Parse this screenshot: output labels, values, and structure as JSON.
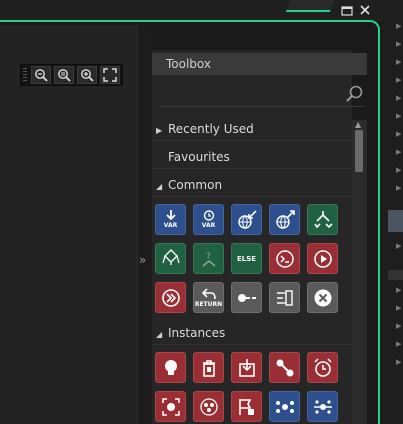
{
  "window": {
    "restore_icon": "restore-icon",
    "close_icon": "close-icon"
  },
  "zoom_toolbar": {
    "buttons": [
      "zoom-out-icon",
      "zoom-reset-icon",
      "zoom-in-icon",
      "fit-screen-icon"
    ]
  },
  "splitter": {
    "expand_label": "»"
  },
  "toolbox": {
    "title": "Toolbox",
    "search": {
      "placeholder": "",
      "value": ""
    },
    "sections": {
      "recently_used": {
        "label": "Recently Used",
        "expanded": false
      },
      "favourites": {
        "label": "Favourites"
      },
      "common": {
        "label": "Common",
        "expanded": true,
        "items": [
          {
            "name": "var-declare",
            "color": "blue",
            "caption": "VAR"
          },
          {
            "name": "var-temp",
            "color": "blue",
            "caption": "VAR"
          },
          {
            "name": "get-global",
            "color": "blue",
            "caption": ""
          },
          {
            "name": "set-global",
            "color": "blue",
            "caption": ""
          },
          {
            "name": "if-condition",
            "color": "green",
            "caption": ""
          },
          {
            "name": "if-variable",
            "color": "green",
            "caption": ""
          },
          {
            "name": "if-undefined",
            "color": "green",
            "caption": ""
          },
          {
            "name": "else",
            "color": "green",
            "caption": "ELSE"
          },
          {
            "name": "execute-code",
            "color": "red",
            "caption": ""
          },
          {
            "name": "call-function",
            "color": "red",
            "caption": ""
          },
          {
            "name": "run-script",
            "color": "red",
            "caption": ""
          },
          {
            "name": "return",
            "color": "gray",
            "caption": "RETURN"
          },
          {
            "name": "exit-event",
            "color": "gray",
            "caption": ""
          },
          {
            "name": "swap-values",
            "color": "gray",
            "caption": ""
          },
          {
            "name": "destroy",
            "color": "gray",
            "caption": ""
          }
        ]
      },
      "instances": {
        "label": "Instances",
        "expanded": true,
        "items": [
          {
            "name": "instance-light",
            "color": "red"
          },
          {
            "name": "instance-destroy",
            "color": "red"
          },
          {
            "name": "instance-create",
            "color": "red"
          },
          {
            "name": "instance-path",
            "color": "red"
          },
          {
            "name": "instance-alarm",
            "color": "red"
          },
          {
            "name": "instance-focus",
            "color": "red"
          },
          {
            "name": "instance-cluster",
            "color": "red"
          },
          {
            "name": "instance-flag",
            "color": "red"
          },
          {
            "name": "instance-spread",
            "color": "blue"
          },
          {
            "name": "instance-merge",
            "color": "blue"
          }
        ]
      }
    }
  }
}
